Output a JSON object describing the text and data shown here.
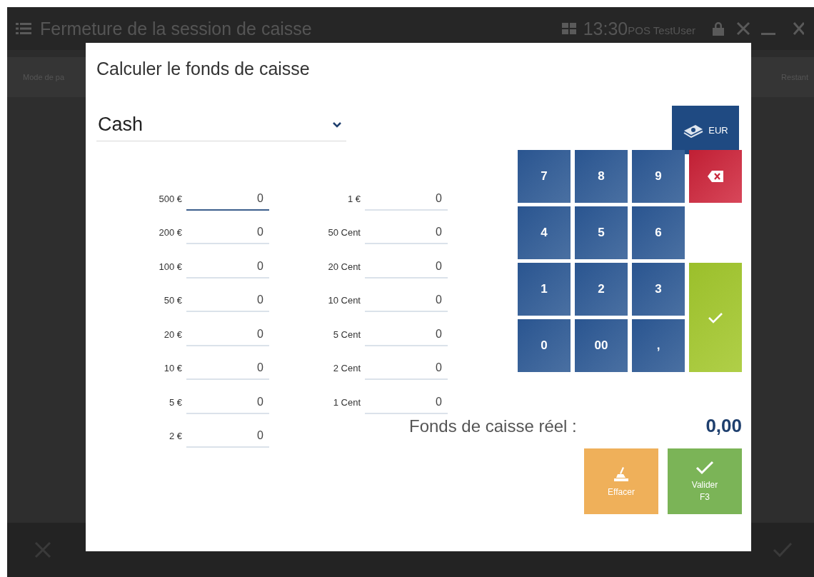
{
  "app": {
    "title": "Fermeture de la session de caisse",
    "time": "13:30",
    "user": "POS TestUser",
    "columns": [
      "Mode de pa",
      "Restant"
    ]
  },
  "dialog": {
    "title": "Calculer le fonds de caisse",
    "payment_method": {
      "value": "Cash"
    },
    "currency_button": "EUR",
    "denomination_columns": [
      [
        {
          "label": "500 €",
          "value": "0",
          "focused": true
        },
        {
          "label": "200 €",
          "value": "0",
          "focused": false
        },
        {
          "label": "100 €",
          "value": "0",
          "focused": false
        },
        {
          "label": "50 €",
          "value": "0",
          "focused": false
        },
        {
          "label": "20 €",
          "value": "0",
          "focused": false
        },
        {
          "label": "10 €",
          "value": "0",
          "focused": false
        },
        {
          "label": "5 €",
          "value": "0",
          "focused": false
        },
        {
          "label": "2 €",
          "value": "0",
          "focused": false
        }
      ],
      [
        {
          "label": "1 €",
          "value": "0",
          "focused": false
        },
        {
          "label": "50 Cent",
          "value": "0",
          "focused": false
        },
        {
          "label": "20 Cent",
          "value": "0",
          "focused": false
        },
        {
          "label": "10 Cent",
          "value": "0",
          "focused": false
        },
        {
          "label": "5 Cent",
          "value": "0",
          "focused": false
        },
        {
          "label": "2 Cent",
          "value": "0",
          "focused": false
        },
        {
          "label": "1 Cent",
          "value": "0",
          "focused": false
        }
      ]
    ],
    "keypad": [
      {
        "kind": "digit",
        "label": "7"
      },
      {
        "kind": "digit",
        "label": "8"
      },
      {
        "kind": "digit",
        "label": "9"
      },
      {
        "kind": "digit",
        "label": "4"
      },
      {
        "kind": "digit",
        "label": "5"
      },
      {
        "kind": "digit",
        "label": "6"
      },
      {
        "kind": "digit",
        "label": "1"
      },
      {
        "kind": "digit",
        "label": "2"
      },
      {
        "kind": "digit",
        "label": "3"
      },
      {
        "kind": "digit",
        "label": "0"
      },
      {
        "kind": "digit",
        "label": "00"
      },
      {
        "kind": "digit",
        "label": ","
      },
      {
        "kind": "backspace"
      },
      {
        "kind": "confirm"
      }
    ],
    "total": {
      "label": "Fonds de caisse réel :",
      "value": "0,00"
    },
    "actions": [
      {
        "kind": "clear",
        "label": "Effacer"
      },
      {
        "kind": "validate",
        "label": "Valider",
        "shortcut": "F3"
      }
    ]
  }
}
